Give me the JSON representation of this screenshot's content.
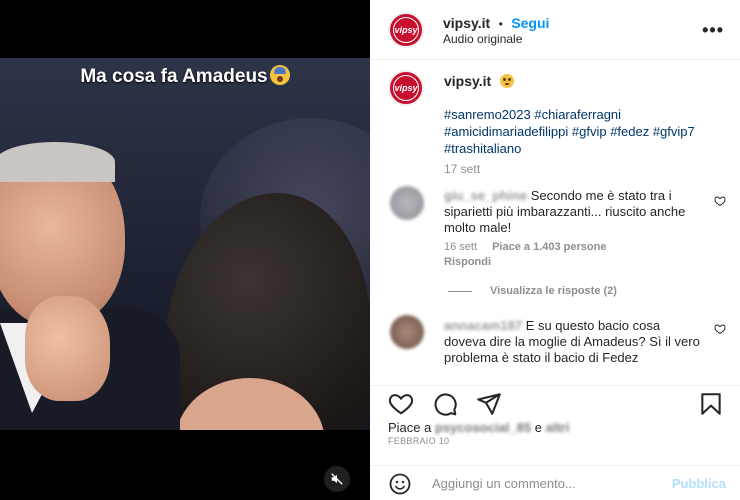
{
  "media": {
    "caption": "Ma cosa fa Amadeus",
    "caption_emoji": "face-screaming-emoji"
  },
  "header": {
    "username": "vipsy.it",
    "separator": "•",
    "follow_label": "Segui",
    "audio": "Audio originale",
    "more": "•••",
    "avatar_text": "vipsy"
  },
  "caption": {
    "username": "vipsy.it",
    "emoji": "flushed-face-emoji",
    "line0": "___________________",
    "hashtags": "#sanremo2023 #chiaraferragni #amicidimariadefilippi #gfvip #fedez #gfvip7 #trashitaliano",
    "time": "17 sett"
  },
  "comments": [
    {
      "username": "giu_se_phine",
      "text": "Secondo me è stato tra i siparietti più imbarazzanti... riuscito anche molto male!",
      "time": "16 sett",
      "likes": "Piace a 1.403 persone",
      "reply": "Rispondi"
    },
    {
      "username": "annacam187",
      "text": "E su questo bacio cosa doveva dire la moglie di Amadeus? Sì il vero problema è stato il bacio di Fedez"
    }
  ],
  "view_replies": "Visualizza le risposte (2)",
  "actions": {
    "likes_prefix": "Piace a",
    "likes_user": "psycosocial_85",
    "likes_and": "e",
    "likes_others": "altri",
    "date": "FEBBRAIO 10"
  },
  "add_comment": {
    "placeholder": "Aggiungi un commento...",
    "publish": "Pubblica"
  },
  "colors": {
    "brand_red": "#c8102e",
    "link_blue": "#0095f6",
    "hashtag_blue": "#00376b",
    "muted": "#8e8e8e"
  }
}
